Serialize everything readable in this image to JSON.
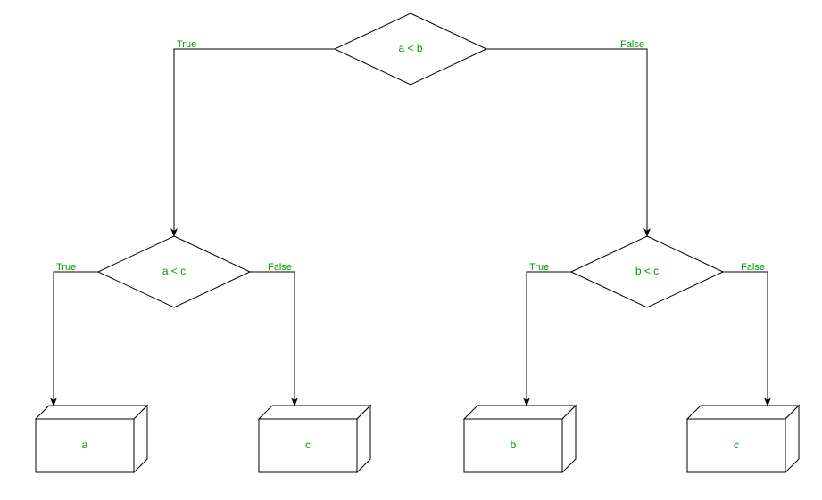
{
  "diagram": {
    "decisions": {
      "root": {
        "label": "a < b"
      },
      "left": {
        "label": "a < c"
      },
      "right": {
        "label": "b < c"
      }
    },
    "leaves": {
      "a": {
        "label": "a"
      },
      "c1": {
        "label": "c"
      },
      "b": {
        "label": "b"
      },
      "c2": {
        "label": "c"
      }
    },
    "edges": {
      "true": "True",
      "false": "False"
    }
  }
}
